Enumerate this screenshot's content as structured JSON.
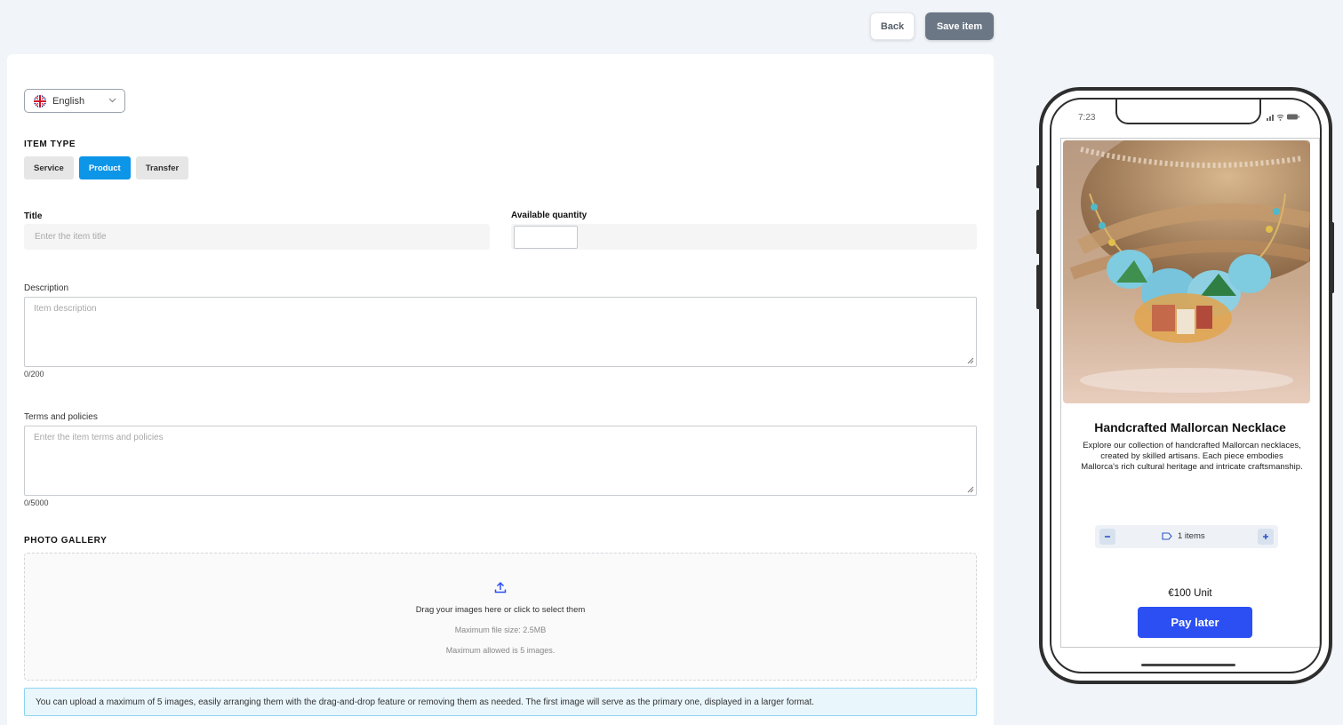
{
  "header": {
    "back_label": "Back",
    "save_label": "Save item"
  },
  "language": {
    "selected": "English"
  },
  "item_type": {
    "section_title": "ITEM TYPE",
    "options": [
      "Service",
      "Product",
      "Transfer"
    ],
    "selected": "Product"
  },
  "title_field": {
    "label": "Title",
    "placeholder": "Enter the item title",
    "value": ""
  },
  "quantity_field": {
    "label": "Available quantity",
    "value": ""
  },
  "description_field": {
    "label": "Description",
    "placeholder": "Item description",
    "counter": "0/200"
  },
  "terms_field": {
    "label": "Terms and policies",
    "placeholder": "Enter the item terms and policies",
    "counter": "0/5000"
  },
  "gallery": {
    "section_title": "PHOTO GALLERY",
    "drop_text": "Drag your images here or click to select them",
    "max_size": "Maximum file size: 2.5MB",
    "max_count": "Maximum allowed is 5 images.",
    "info": "You can upload a maximum of 5 images, easily arranging them with the drag-and-drop feature or removing them as needed. The first image will serve as the primary one, displayed in a larger format."
  },
  "preview": {
    "status_time": "7:23",
    "product_title": "Handcrafted Mallorcan Necklace",
    "product_description": "Explore our collection of handcrafted Mallorcan necklaces, created by skilled artisans. Each piece embodies Mallorca's rich cultural heritage and intricate craftsmanship.",
    "quantity_text": "1 items",
    "price_text": "€100 Unit",
    "pay_label": "Pay later"
  },
  "colors": {
    "primary_active": "#0d95e8",
    "pay_button": "#2b4ff3",
    "save_button": "#6b7785",
    "info_bg": "#e9f6fc"
  }
}
